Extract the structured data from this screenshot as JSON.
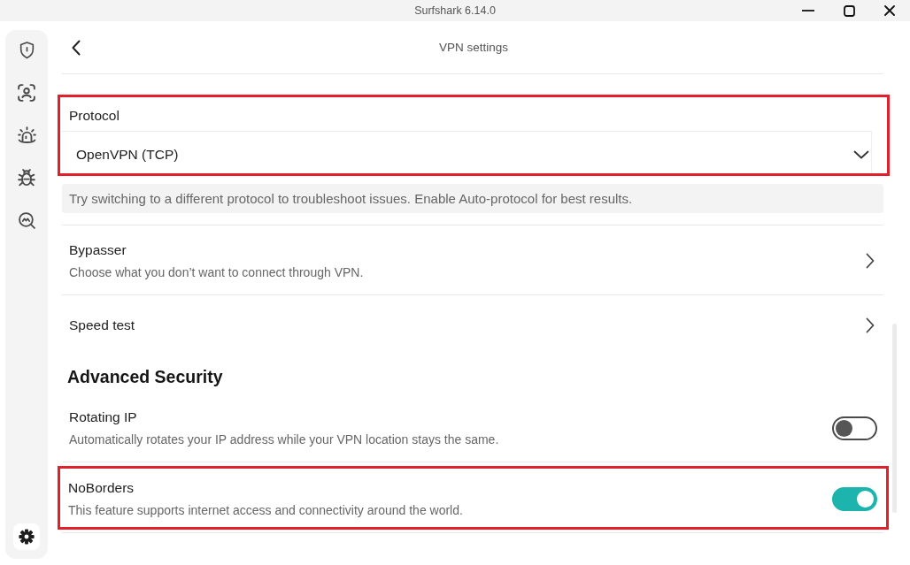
{
  "window": {
    "title": "Surfshark 6.14.0"
  },
  "sidebar": {
    "items": [
      {
        "kind": "shield",
        "selected": false
      },
      {
        "kind": "profile",
        "selected": false
      },
      {
        "kind": "alarm",
        "selected": false
      },
      {
        "kind": "bug",
        "selected": false
      },
      {
        "kind": "search",
        "selected": false
      }
    ],
    "footer_items": [
      {
        "kind": "settings",
        "selected": true
      }
    ]
  },
  "header": {
    "title": "VPN settings"
  },
  "protocol": {
    "label": "Protocol",
    "value": "OpenVPN (TCP)",
    "highlighted": true,
    "hint": "Try switching to a different protocol to troubleshoot issues. Enable Auto-protocol for best results."
  },
  "settings": [
    {
      "kind": "link",
      "title": "Bypasser",
      "subtitle": "Choose what you don’t want to connect through VPN.",
      "highlighted": false
    },
    {
      "kind": "link",
      "title": "Speed test",
      "highlighted": false
    }
  ],
  "sections": [
    {
      "heading": "Advanced Security",
      "settings": [
        {
          "kind": "toggle",
          "title": "Rotating IP",
          "subtitle": "Automatically rotates your IP address while your VPN location stays the same.",
          "on": false,
          "highlighted": false
        },
        {
          "kind": "toggle",
          "title": "NoBorders",
          "subtitle": "This feature supports internet access and connectivity around the world.",
          "on": true,
          "highlighted": true
        }
      ]
    }
  ]
}
